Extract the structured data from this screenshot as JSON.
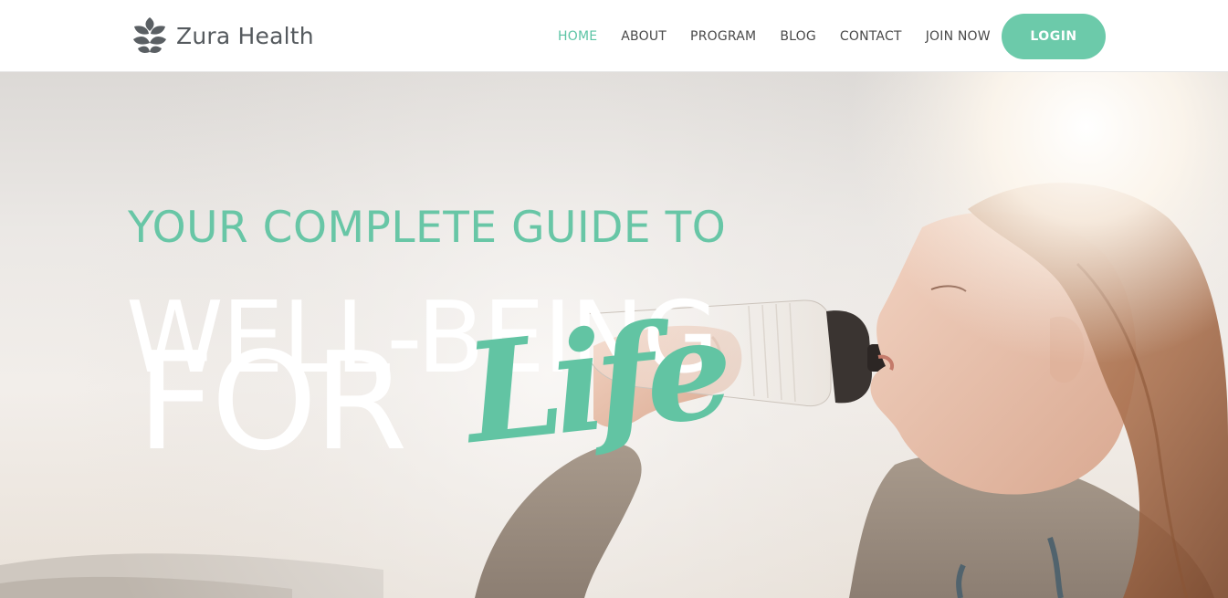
{
  "brand": {
    "name": "Zura Health",
    "logo_icon": "lotus-leaf-icon",
    "accent_color": "#68c6a6"
  },
  "nav": {
    "items": [
      {
        "label": "HOME",
        "active": true
      },
      {
        "label": "ABOUT",
        "active": false
      },
      {
        "label": "PROGRAM",
        "active": false
      },
      {
        "label": "BLOG",
        "active": false
      },
      {
        "label": "CONTACT",
        "active": false
      },
      {
        "label": "JOIN NOW",
        "active": false
      }
    ],
    "login_label": "LOGIN"
  },
  "hero": {
    "line1": "YOUR COMPLETE GUIDE TO",
    "line2": "WELL-BEING",
    "line3": "FOR",
    "script_word": "Life",
    "image": "woman-drinking-water-bottle-photo"
  }
}
